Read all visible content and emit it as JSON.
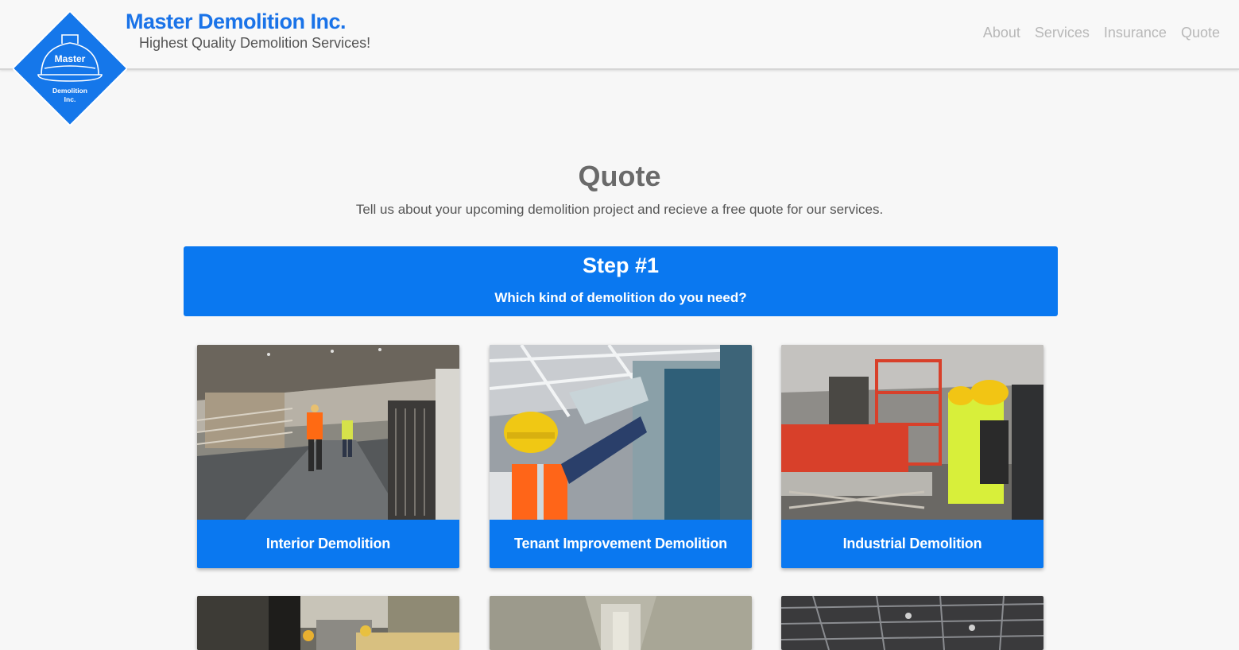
{
  "brand": {
    "title": "Master Demolition Inc.",
    "subtitle": "Highest Quality Demolition Services!",
    "logo_line1": "Master",
    "logo_line2": "Demolition",
    "logo_line3": "Inc."
  },
  "nav": {
    "items": [
      {
        "label": "About"
      },
      {
        "label": "Services"
      },
      {
        "label": "Insurance"
      },
      {
        "label": "Quote"
      }
    ]
  },
  "intro": {
    "title": "Quote",
    "description": "Tell us about your upcoming demolition project and recieve a free quote for our services."
  },
  "step": {
    "title": "Step #1",
    "question": "Which kind of demolition do you need?"
  },
  "cards": [
    {
      "label": "Interior Demolition",
      "image": "warehouse-workers-photo"
    },
    {
      "label": "Tenant Improvement Demolition",
      "image": "ceiling-worker-photo"
    },
    {
      "label": "Industrial Demolition",
      "image": "scissor-lift-workers-photo"
    }
  ],
  "colors": {
    "accent": "#0a78f0",
    "brand_text": "#1a73e8",
    "nav_text": "#b8b8b8",
    "background": "#f7f7f7"
  }
}
